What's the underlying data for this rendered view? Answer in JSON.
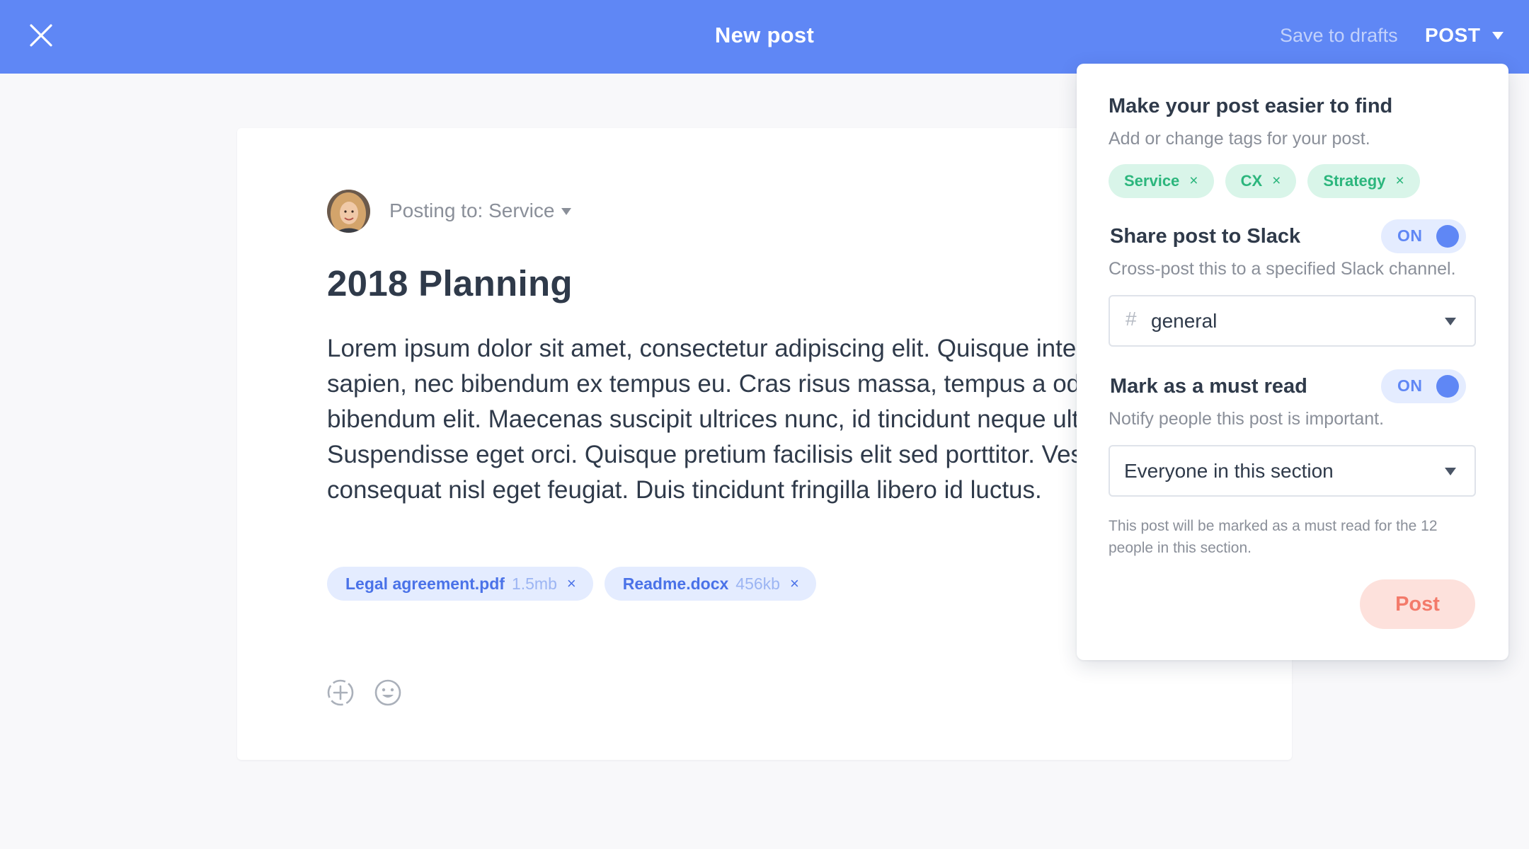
{
  "colors": {
    "header": "#5f87f5",
    "accent": "#5f87f5",
    "tag_bg": "#d9f5e9",
    "tag_text": "#2cb67d",
    "post_button_bg": "#fde1dc",
    "post_button_text": "#f37a6a"
  },
  "header": {
    "close_icon": "close-icon",
    "title": "New post",
    "save_drafts_label": "Save to drafts",
    "post_menu_label": "POST"
  },
  "editor": {
    "posting_to": "Posting to: Service",
    "title": "2018 Planning",
    "body": "Lorem ipsum dolor sit amet, consectetur adipiscing elit. Quisque interdum vulputate sapien, nec bibendum ex tempus eu. Cras risus massa, tempus a odio ut, tincidunt bibendum elit. Maecenas suscipit ultrices nunc, id tincidunt neque ultrices mattis. Suspendisse eget orci. Quisque pretium facilisis elit sed porttitor. Vestibulum consequat nisl eget feugiat. Duis tincidunt fringilla libero id luctus.",
    "attachments": [
      {
        "name": "Legal agreement.pdf",
        "size": "1.5mb",
        "remove": "×"
      },
      {
        "name": "Readme.docx",
        "size": "456kb",
        "remove": "×"
      }
    ],
    "tools": [
      "add-attachment-icon",
      "emoji-icon"
    ]
  },
  "panel": {
    "find": {
      "heading": "Make your post easier to find",
      "subtitle": "Add or change tags for your post.",
      "tags": [
        {
          "label": "Service",
          "remove": "×"
        },
        {
          "label": "CX",
          "remove": "×"
        },
        {
          "label": "Strategy",
          "remove": "×"
        }
      ]
    },
    "slack": {
      "heading": "Share post to Slack",
      "toggle": "ON",
      "subtitle": "Cross-post this to a specified Slack channel.",
      "hash": "#",
      "channel": "general"
    },
    "must_read": {
      "heading": "Mark as a must read",
      "toggle": "ON",
      "subtitle": "Notify people this post is important.",
      "audience": "Everyone in this section",
      "note": "This post will be marked as a must read for the 12 people in this section."
    },
    "post_button": "Post"
  }
}
